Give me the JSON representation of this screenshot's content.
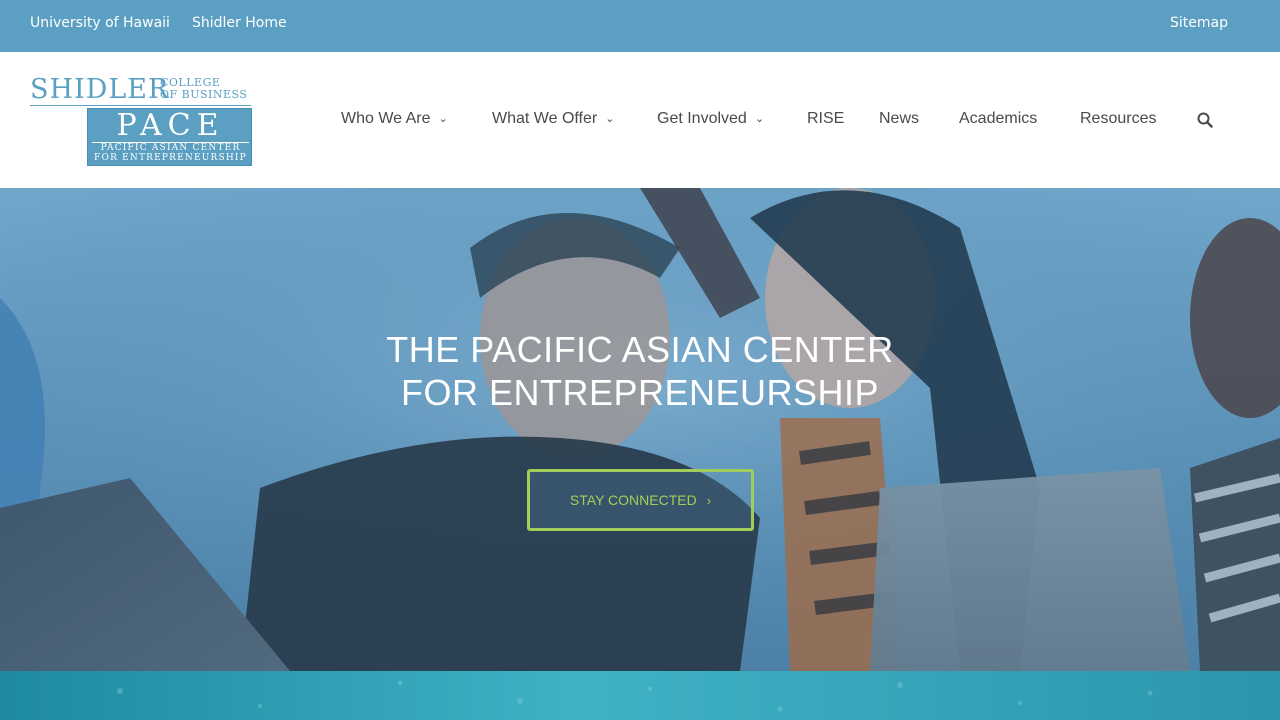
{
  "topbar": {
    "university_link": "University of Hawaii",
    "home_link": "Shidler Home",
    "sitemap_link": "Sitemap"
  },
  "logo": {
    "shidler": "SHIDLER",
    "college_line1": "COLLEGE",
    "college_line2": "OF BUSINESS",
    "pace": "PACE",
    "sub_line1": "PACIFIC ASIAN CENTER",
    "sub_line2": "FOR ENTREPRENEURSHIP"
  },
  "nav": {
    "items": [
      {
        "label": "Who We Are",
        "has_dropdown": true
      },
      {
        "label": "What We Offer",
        "has_dropdown": true
      },
      {
        "label": "Get Involved",
        "has_dropdown": true
      },
      {
        "label": "RISE",
        "has_dropdown": false
      },
      {
        "label": "News",
        "has_dropdown": false
      },
      {
        "label": "Academics",
        "has_dropdown": false
      },
      {
        "label": "Resources",
        "has_dropdown": false
      }
    ],
    "search_icon": "search-icon"
  },
  "hero": {
    "title_line1": "THE PACIFIC ASIAN CENTER",
    "title_line2": "FOR ENTREPRENEURSHIP",
    "cta_label": "STAY CONNECTED",
    "cta_icon": "chevron-right-icon"
  },
  "colors": {
    "topbar": "#5b9fc2",
    "cta_accent": "#9fcf5a",
    "nav_text": "#4a4a4a"
  }
}
